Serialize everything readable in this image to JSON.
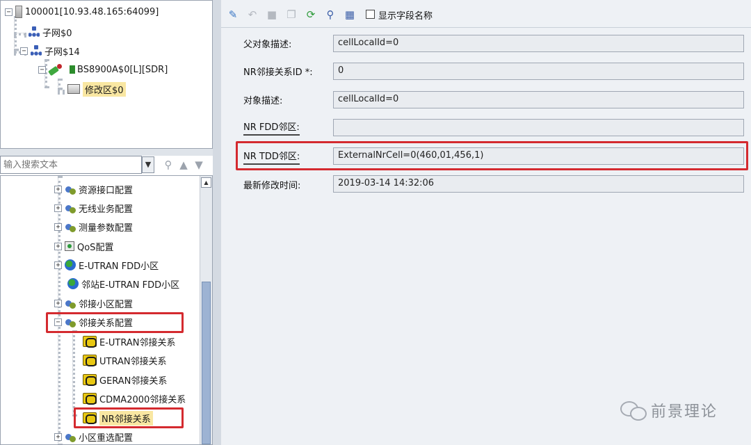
{
  "top_tree": {
    "root": "100001[10.93.48.165:64099]",
    "subnet_0": "子网$0",
    "subnet_14": "子网$14",
    "base_station": "BS8900A$0[L][SDR]",
    "modify_area": "修改区$0"
  },
  "search": {
    "placeholder": "输入搜索文本"
  },
  "config_tree": {
    "items": [
      "资源接口配置",
      "无线业务配置",
      "测量参数配置",
      "QoS配置",
      "E-UTRAN FDD小区",
      "邻站E-UTRAN FDD小区",
      "邻接小区配置",
      "邻接关系配置",
      "E-UTRAN邻接关系",
      "UTRAN邻接关系",
      "GERAN邻接关系",
      "CDMA2000邻接关系",
      "NR邻接关系",
      "小区重选配置"
    ]
  },
  "toolbar": {
    "show_field_names": "显示字段名称"
  },
  "form": {
    "parent_desc_label": "父对象描述:",
    "parent_desc_value": "cellLocalId=0",
    "nr_relation_id_label": "NR邻接关系ID *:",
    "nr_relation_id_value": "0",
    "object_desc_label": "对象描述:",
    "object_desc_value": "cellLocalId=0",
    "nr_fdd_label": "NR FDD邻区:",
    "nr_fdd_value": "",
    "nr_tdd_label": "NR TDD邻区:",
    "nr_tdd_value": "ExternalNrCell=0(460,01,456,1)",
    "last_modified_label": "最新修改时间:",
    "last_modified_value": "2019-03-14 14:32:06"
  },
  "watermark": {
    "text": "前景理论"
  },
  "colors": {
    "highlight_box": "#d42a2f",
    "selection": "#f9e7a2",
    "panel_bg": "#eef1f5"
  },
  "icons": {
    "root": "server-icon",
    "subnet": "network-icon",
    "base_station": "base-station-icon",
    "modify_area": "form-icon",
    "config": "config-icon",
    "relation": "neighbor-relation-icon"
  }
}
